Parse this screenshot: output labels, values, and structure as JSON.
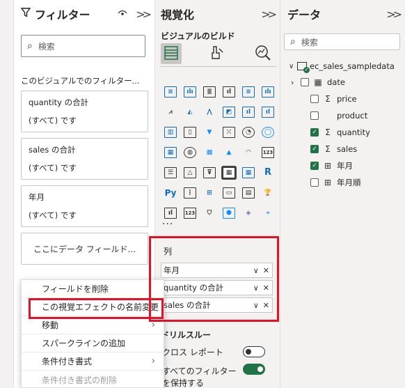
{
  "filters": {
    "title": "フィルター",
    "search_placeholder": "検索",
    "section_label": "このビジュアルでのフィルター...",
    "cards": [
      {
        "title": "quantity の合計",
        "value": "(すべて) です"
      },
      {
        "title": "sales の合計",
        "value": "(すべて) です"
      },
      {
        "title": "年月",
        "value": "(すべて) です"
      }
    ],
    "drop_label": "ここにデータ フィールド..."
  },
  "visualizations": {
    "title": "視覚化",
    "build_label": "ビジュアルのビルド",
    "more": "...",
    "columns_label": "列",
    "columns": [
      "年月",
      "quantity の合計",
      "sales の合計"
    ],
    "drillthrough_label": "ドリルスルー",
    "cross_report_label": "クロス レポート",
    "keep_filters_label_1": "すべてのフィルター",
    "keep_filters_label_2": "を保持する",
    "cross_report_enabled": false,
    "keep_filters_enabled": true
  },
  "data": {
    "title": "データ",
    "search_placeholder": "検索",
    "table_name": "ec_sales_sampledata",
    "fields": [
      {
        "name": "date",
        "icon": "calendar-icon",
        "checked": false,
        "expandable": true
      },
      {
        "name": "price",
        "icon": "sigma-icon",
        "checked": false,
        "expandable": false
      },
      {
        "name": "product",
        "icon": "",
        "checked": false,
        "expandable": false
      },
      {
        "name": "quantity",
        "icon": "sigma-icon",
        "checked": true,
        "expandable": false
      },
      {
        "name": "sales",
        "icon": "sigma-icon",
        "checked": true,
        "expandable": false
      },
      {
        "name": "年月",
        "icon": "calculated-column-icon",
        "checked": true,
        "expandable": false
      },
      {
        "name": "年月順",
        "icon": "calculated-column-icon",
        "checked": false,
        "expandable": false
      }
    ]
  },
  "context_menu": {
    "items": [
      {
        "label": "フィールドを削除",
        "submenu": false,
        "disabled": false
      },
      {
        "label": "この視覚エフェクトの名前変更",
        "submenu": false,
        "disabled": false
      },
      {
        "label": "移動",
        "submenu": true,
        "disabled": false
      },
      {
        "label": "スパークラインの追加",
        "submenu": false,
        "disabled": false
      },
      {
        "label": "条件付き書式",
        "submenu": true,
        "disabled": false
      },
      {
        "label": "条件付き書式の削除",
        "submenu": false,
        "disabled": true
      }
    ]
  },
  "colors": {
    "highlight": "#e81123",
    "check": "#217346"
  }
}
